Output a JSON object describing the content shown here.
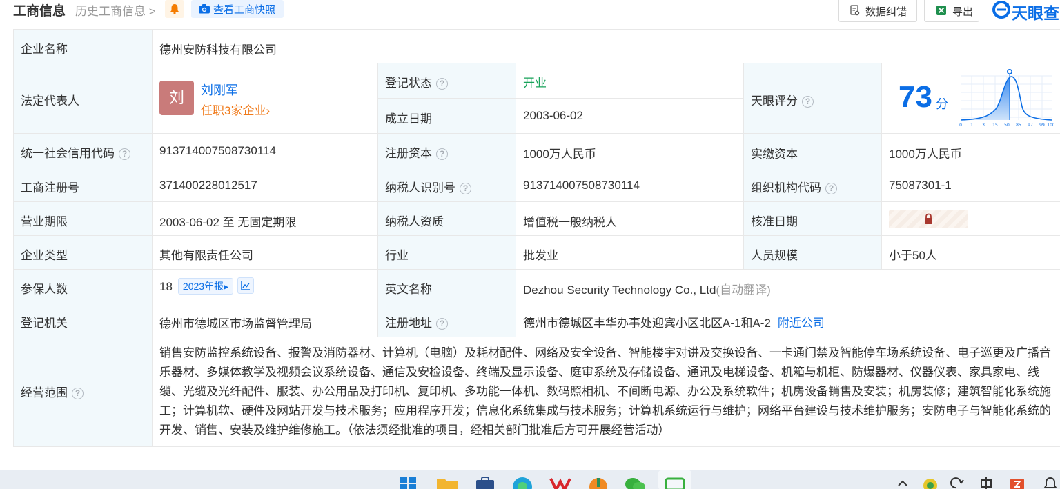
{
  "header": {
    "title": "工商信息",
    "history_label": "历史工商信息",
    "snapshot_label": "查看工商快照",
    "correct_label": "数据纠错",
    "export_label": "导出",
    "logo_text": "天眼查"
  },
  "rows": {
    "company_name": {
      "label": "企业名称",
      "value": "德州安防科技有限公司"
    },
    "legal_rep": {
      "label": "法定代表人",
      "avatar_char": "刘",
      "name": "刘刚军",
      "sub": "任职3家企业"
    },
    "reg_status": {
      "label": "登记状态",
      "value": "开业"
    },
    "found_date": {
      "label": "成立日期",
      "value": "2003-06-02"
    },
    "score": {
      "label": "天眼评分",
      "value": "73",
      "unit": "分",
      "axis_ticks": [
        "0",
        "1",
        "3",
        "15",
        "50",
        "85",
        "97",
        "99",
        "100"
      ]
    },
    "credit_code": {
      "label": "统一社会信用代码",
      "value": "913714007508730114"
    },
    "reg_capital": {
      "label": "注册资本",
      "value": "1000万人民币"
    },
    "paid_capital": {
      "label": "实缴资本",
      "value": "1000万人民币"
    },
    "reg_no": {
      "label": "工商注册号",
      "value": "371400228012517"
    },
    "taxpayer_id": {
      "label": "纳税人识别号",
      "value": "913714007508730114"
    },
    "org_code": {
      "label": "组织机构代码",
      "value": "75087301-1"
    },
    "biz_term": {
      "label": "营业期限",
      "value": "2003-06-02 至 无固定期限"
    },
    "tax_quality": {
      "label": "纳税人资质",
      "value": "增值税一般纳税人"
    },
    "approve_date": {
      "label": "核准日期"
    },
    "company_type": {
      "label": "企业类型",
      "value": "其他有限责任公司"
    },
    "industry": {
      "label": "行业",
      "value": "批发业"
    },
    "staff_size": {
      "label": "人员规模",
      "value": "小于50人"
    },
    "insured": {
      "label": "参保人数",
      "value": "18",
      "year_tag": "2023年报"
    },
    "english_name": {
      "label": "英文名称",
      "value": "Dezhou Security Technology Co., Ltd",
      "note": "(自动翻译)"
    },
    "reg_authority": {
      "label": "登记机关",
      "value": "德州市德城区市场监督管理局"
    },
    "reg_address": {
      "label": "注册地址",
      "value": "德州市德城区丰华办事处迎宾小区北区A-1和A-2",
      "link": "附近公司"
    },
    "biz_scope": {
      "label": "经营范围",
      "value": "销售安防监控系统设备、报警及消防器材、计算机（电脑）及耗材配件、网络及安全设备、智能楼宇对讲及交换设备、一卡通门禁及智能停车场系统设备、电子巡更及广播音乐器材、多媒体教学及视频会议系统设备、通信及安检设备、终端及显示设备、庭审系统及存储设备、通讯及电梯设备、机箱与机柜、防爆器材、仪器仪表、家具家电、线缆、光缆及光纤配件、服装、办公用品及打印机、复印机、多功能一体机、数码照相机、不间断电源、办公及系统软件；机房设备销售及安装；机房装修；建筑智能化系统施工；计算机软、硬件及网站开发与技术服务；应用程序开发；信息化系统集成与技术服务；计算机系统运行与维护；网络平台建设与技术维护服务；安防电子与智能化系统的开发、销售、安装及维护维修施工。（依法须经批准的项目，经相关部门批准后方可开展经营活动）"
    }
  },
  "colors": {
    "label_bg": "#f2f9fc",
    "link": "#0b6ee6",
    "status_green": "#18a35a",
    "accent_orange": "#f07a1a",
    "avatar_bg": "#c97b7a"
  }
}
